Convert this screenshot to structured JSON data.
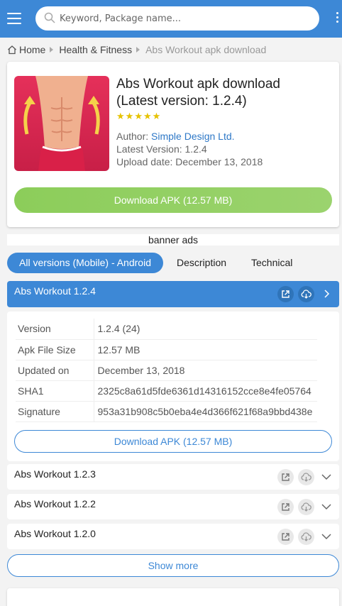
{
  "header": {
    "search_placeholder": "Keyword, Package name..."
  },
  "breadcrumb": {
    "home": "Home",
    "category": "Health & Fitness",
    "current": "Abs Workout apk download"
  },
  "app": {
    "title_line1": "Abs Workout apk download",
    "title_line2": "(Latest version: 1.2.4)",
    "rating_stars": 5,
    "author_label": "Author:",
    "author": "Simple Design Ltd.",
    "latest_version_label": "Latest Version:",
    "latest_version": "1.2.4",
    "upload_date_label": "Upload date:",
    "upload_date": "December 13, 2018",
    "download_label": "Download APK (12.57 MB)"
  },
  "banner": "banner ads",
  "tabs": [
    {
      "label": "All versions (Mobile) - Android",
      "active": true
    },
    {
      "label": "Description",
      "active": false
    },
    {
      "label": "Technical",
      "active": false
    }
  ],
  "versions": [
    {
      "name": "Abs Workout 1.2.4",
      "expanded": true
    },
    {
      "name": "Abs Workout 1.2.3",
      "expanded": false
    },
    {
      "name": "Abs Workout 1.2.2",
      "expanded": false
    },
    {
      "name": "Abs Workout 1.2.0",
      "expanded": false
    }
  ],
  "version_details": {
    "rows": [
      {
        "key": "Version",
        "value": "1.2.4 (24)"
      },
      {
        "key": "Apk File Size",
        "value": "12.57 MB"
      },
      {
        "key": "Updated on",
        "value": "December 13, 2018"
      },
      {
        "key": "SHA1",
        "value": "2325c8a61d5fde6361d14316152cce8e4fe05764"
      },
      {
        "key": "Signature",
        "value": "953a31b908c5b0eba4e4d366f621f68a9bbd438e"
      }
    ],
    "download_label": "Download APK (12.57 MB)"
  },
  "show_more": "Show more",
  "colors": {
    "primary": "#3d88d6",
    "download_green": "#8ccd5a",
    "star": "#e6c200",
    "link": "#2e78c7"
  },
  "icons": [
    "menu-icon",
    "search-icon",
    "kebab-icon",
    "home-icon",
    "external-link-icon",
    "cloud-download-icon",
    "chevron-right-icon",
    "chevron-down-icon"
  ]
}
